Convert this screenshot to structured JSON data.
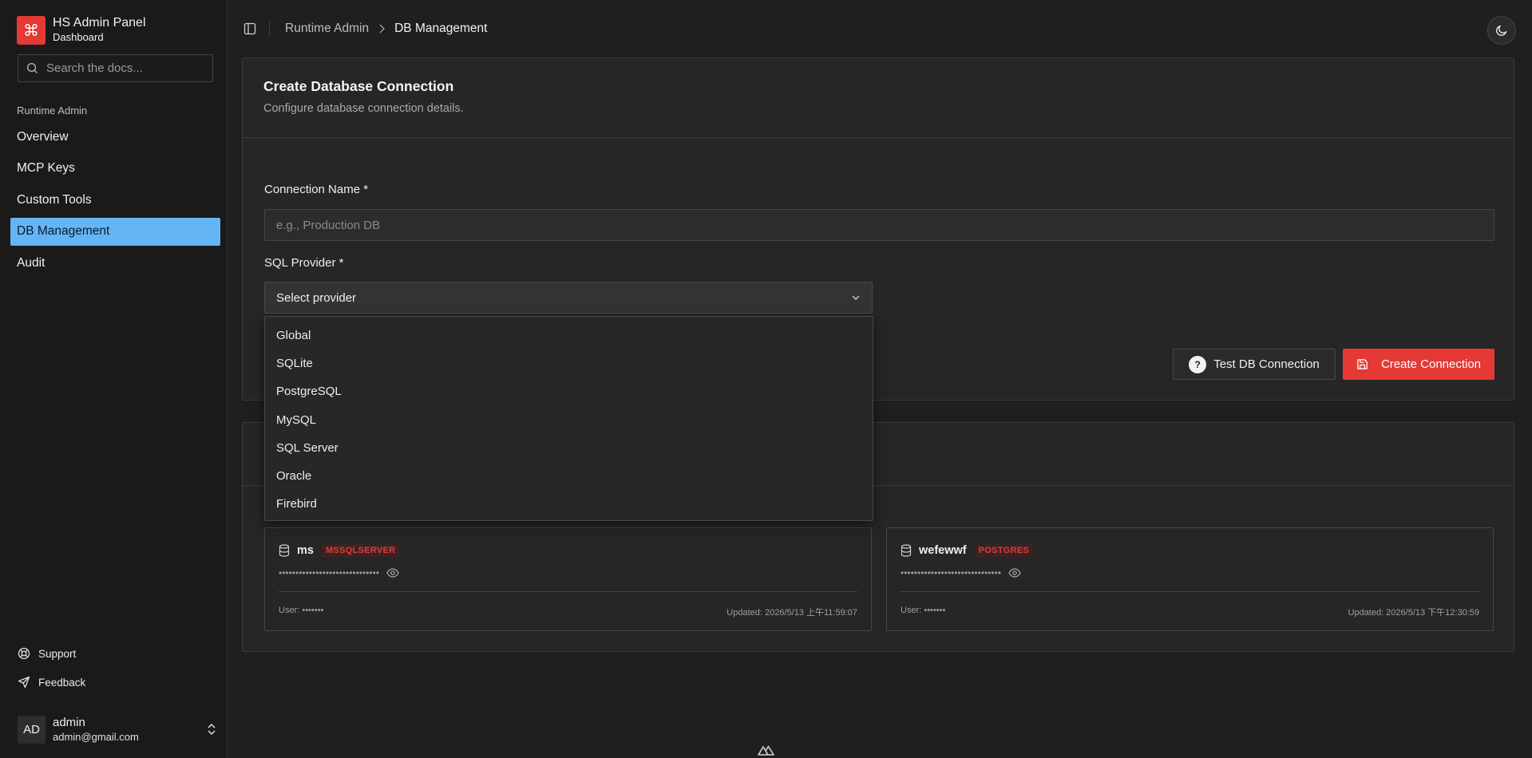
{
  "sidebar": {
    "brand_title": "HS Admin Panel",
    "brand_subtitle": "Dashboard",
    "brand_icon": "⌘",
    "search_placeholder": "Search the docs...",
    "group_label": "Runtime Admin",
    "items": [
      {
        "label": "Overview"
      },
      {
        "label": "MCP Keys"
      },
      {
        "label": "Custom Tools"
      },
      {
        "label": "DB Management",
        "active": true
      },
      {
        "label": "Audit"
      }
    ],
    "support_label": "Support",
    "feedback_label": "Feedback",
    "user": {
      "initials": "AD",
      "name": "admin",
      "email": "admin@gmail.com"
    }
  },
  "header": {
    "breadcrumb": [
      "Runtime Admin",
      "DB Management"
    ]
  },
  "form": {
    "title": "Create Database Connection",
    "description": "Configure database connection details.",
    "name_label": "Connection Name *",
    "name_placeholder": "e.g., Production DB",
    "provider_label": "SQL Provider *",
    "provider_value": "Select provider",
    "provider_options": [
      "Global",
      "SQLite",
      "PostgreSQL",
      "MySQL",
      "SQL Server",
      "Oracle",
      "Firebird"
    ],
    "test_button": "Test DB Connection",
    "create_button": "Create Connection"
  },
  "connections": [
    {
      "name": "ms",
      "badge": "MSSQLSERVER",
      "secret": "••••••••••••••••••••••••••••••",
      "user": "User: •••••••",
      "updated": "Updated: 2026/5/13 上午11:59:07"
    },
    {
      "name": "wefewwf",
      "badge": "POSTGRES",
      "secret": "••••••••••••••••••••••••••••••",
      "user": "User: •••••••",
      "updated": "Updated: 2026/5/13 下午12:30:59"
    }
  ],
  "colors": {
    "accent_red": "#e53935",
    "active_nav": "#64b5f6",
    "background": "#1f1f1f"
  }
}
